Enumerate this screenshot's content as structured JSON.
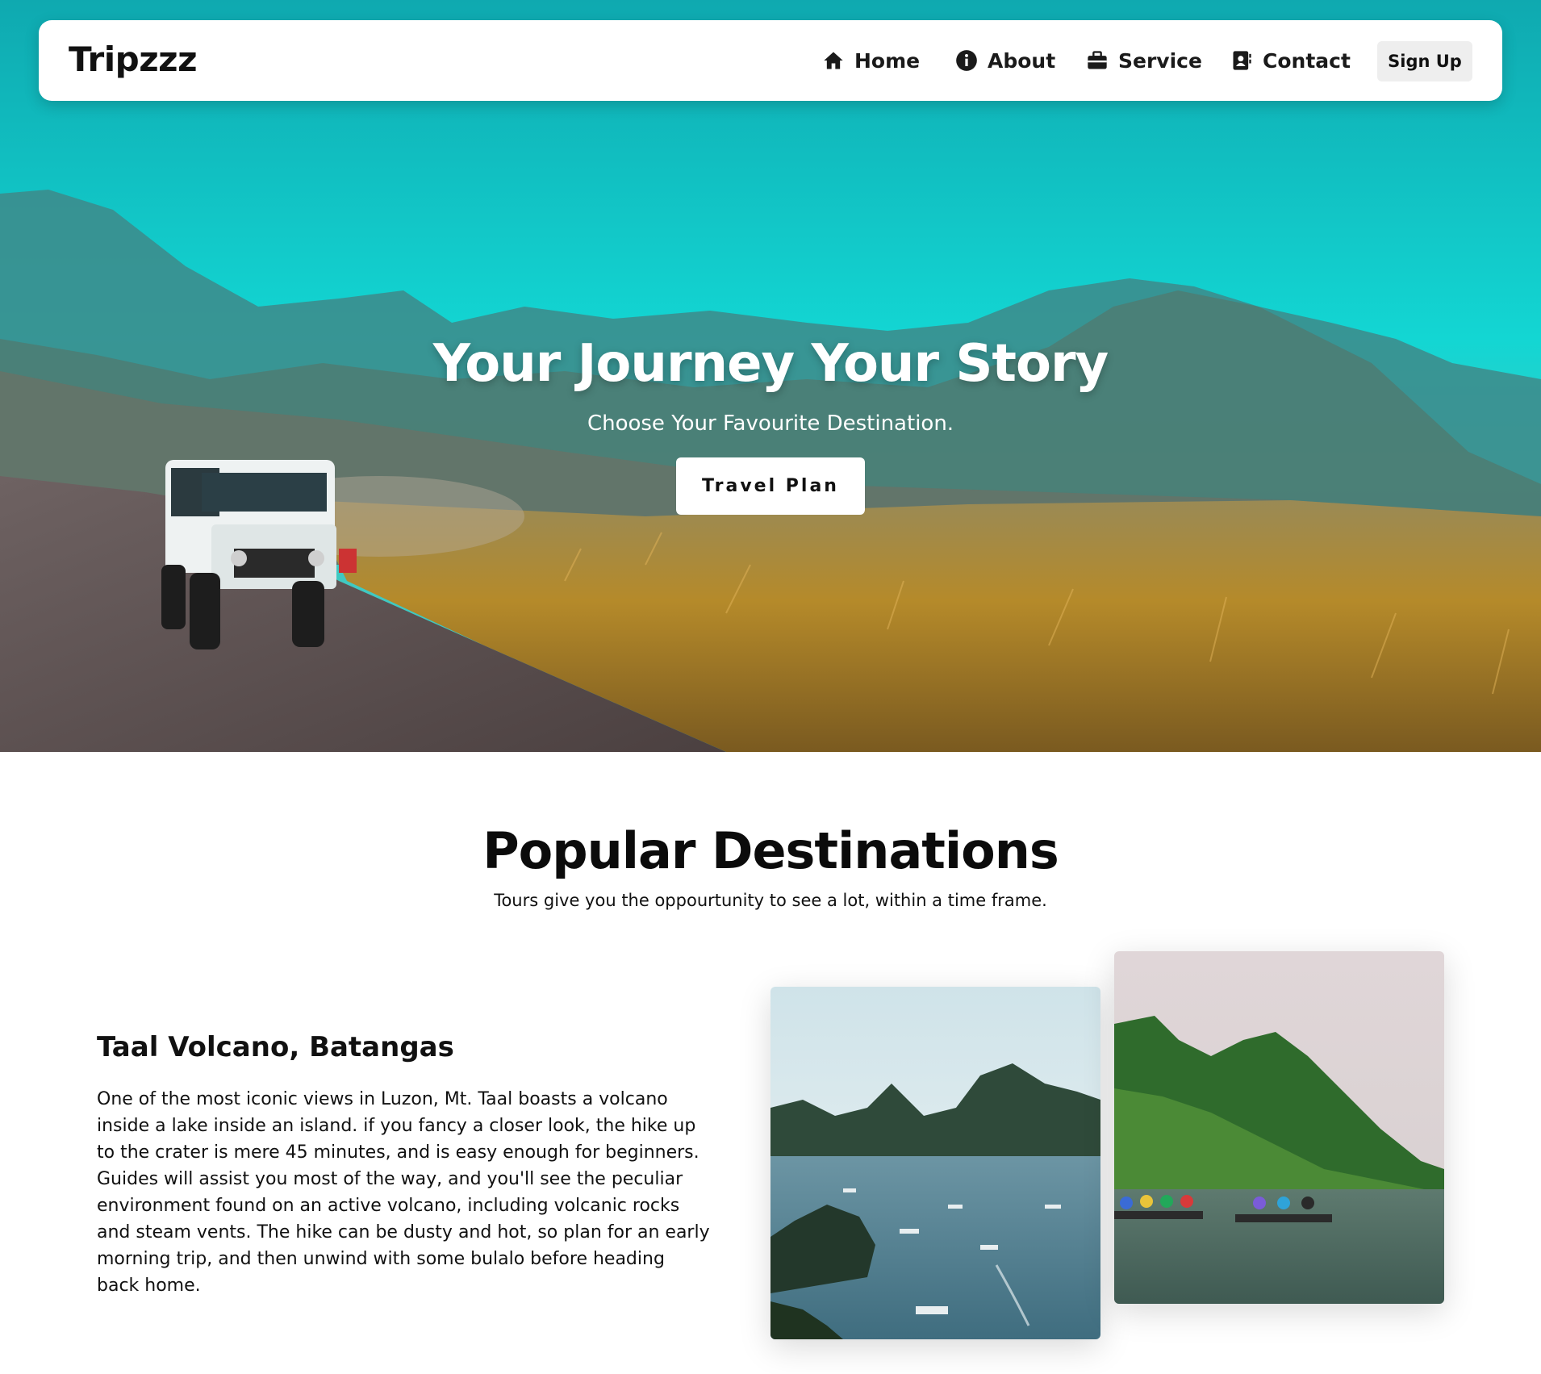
{
  "brand": {
    "logo": "Tripzzz"
  },
  "nav": {
    "items": [
      {
        "label": "Home",
        "icon": "home-icon"
      },
      {
        "label": "About",
        "icon": "info-circle-icon"
      },
      {
        "label": "Service",
        "icon": "briefcase-icon"
      },
      {
        "label": "Contact",
        "icon": "address-book-icon"
      }
    ],
    "signup_label": "Sign Up"
  },
  "hero": {
    "title": "Your Journey Your Story",
    "subtitle": "Choose Your Favourite Destination.",
    "cta_label": "Travel Plan",
    "image": "jeep-on-dirt-road-mountains-photo"
  },
  "popular": {
    "title": "Popular Destinations",
    "subtitle": "Tours give you the oppourtunity to see a lot, within a time frame.",
    "destination": {
      "name": "Taal Volcano, Batangas",
      "description": "One of the most iconic views in Luzon, Mt. Taal boasts a volcano inside a lake inside an island. if you fancy a closer look, the hike up to the crater is mere 45 minutes, and is easy enough for beginners. Guides will assist you most of the way, and you'll see the peculiar environment found on an active volcano, including volcanic rocks and steam vents. The hike can be dusty and hot, so plan for an early morning trip, and then unwind with some bulalo before heading back home."
    },
    "images": [
      {
        "name": "bay-islands-boats-photo"
      },
      {
        "name": "river-boats-green-hills-photo"
      }
    ]
  },
  "colors": {
    "sky": "#12c9cc",
    "accent_text": "#ffffff",
    "button_bg": "#ffffff",
    "signup_bg": "#eeeeee"
  }
}
